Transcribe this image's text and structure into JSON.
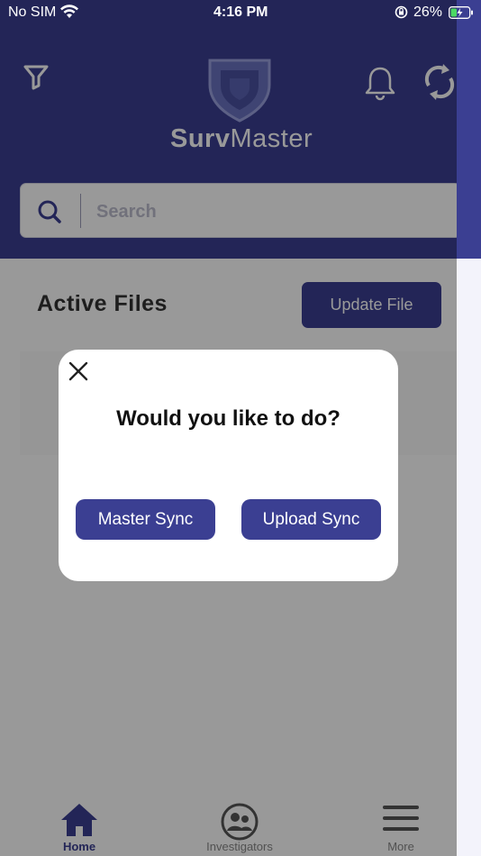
{
  "status_bar": {
    "carrier": "No SIM",
    "time": "4:16 PM",
    "battery_pct": "26%"
  },
  "header": {
    "brand_bold": "Surv",
    "brand_light": "Master"
  },
  "search": {
    "placeholder": "Search"
  },
  "main": {
    "section_title": "Active Files",
    "update_button": "Update File"
  },
  "modal": {
    "title": "Would you like to do?",
    "master_sync": "Master Sync",
    "upload_sync": "Upload Sync"
  },
  "tabs": [
    {
      "label": "Home",
      "icon": "home-icon",
      "active": true
    },
    {
      "label": "Investigators",
      "icon": "investigators-icon",
      "active": false
    },
    {
      "label": "More",
      "icon": "menu-icon",
      "active": false
    }
  ],
  "colors": {
    "primary": "#3b3f92",
    "background": "#ffffff"
  }
}
